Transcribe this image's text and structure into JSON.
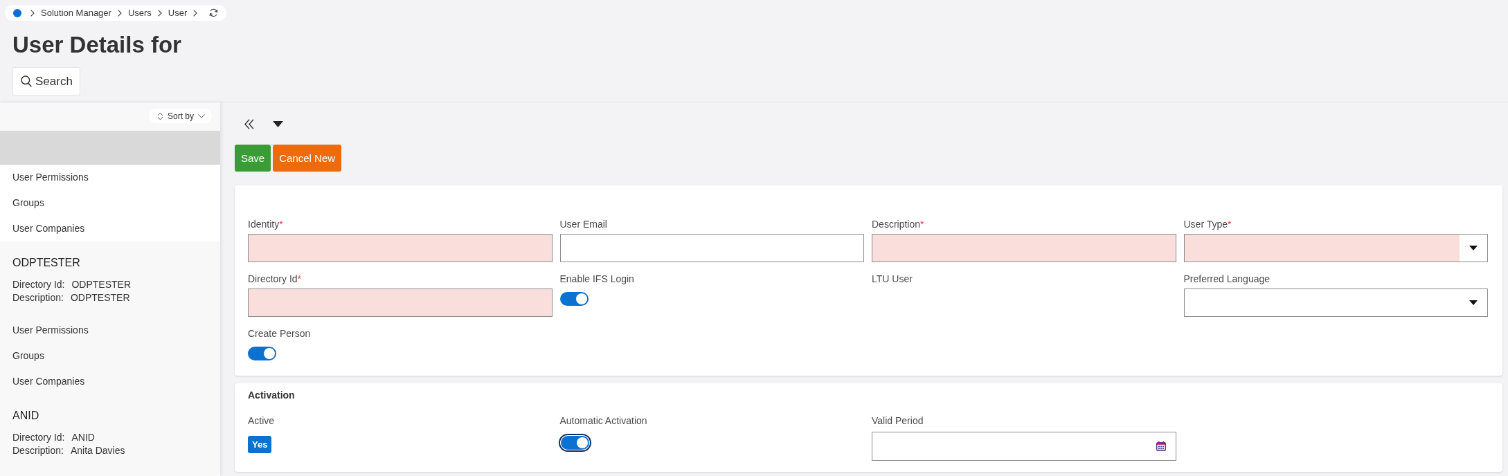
{
  "breadcrumb": {
    "items": [
      "Solution Manager",
      "Users",
      "User"
    ]
  },
  "page_title": "User Details for",
  "search_button": "Search",
  "sidebar": {
    "sort_label": "Sort by",
    "records": [
      {
        "selected": true,
        "links": [
          "User Permissions",
          "Groups",
          "User Companies"
        ]
      },
      {
        "selected": false,
        "title": "ODPTESTER",
        "details": [
          {
            "label": "Directory Id:",
            "value": "ODPTESTER"
          },
          {
            "label": "Description:",
            "value": "ODPTESTER"
          }
        ],
        "links": [
          "User Permissions",
          "Groups",
          "User Companies"
        ]
      },
      {
        "selected": false,
        "title": "ANID",
        "details": [
          {
            "label": "Directory Id:",
            "value": "ANID"
          },
          {
            "label": "Description:",
            "value": "Anita Davies"
          }
        ]
      }
    ]
  },
  "toolbar": {
    "buttons": [
      {
        "kind": "save",
        "label": "Save"
      },
      {
        "kind": "cancel",
        "label": "Cancel New"
      }
    ]
  },
  "details_form": {
    "fields": [
      {
        "kind": "text",
        "label": "Identity",
        "asterisk": "*",
        "required": true
      },
      {
        "kind": "text",
        "label": "User Email",
        "required": false
      },
      {
        "kind": "text",
        "label": "Description",
        "asterisk": "*",
        "required": true
      },
      {
        "kind": "select",
        "label": "User Type",
        "asterisk": "*",
        "required": true
      },
      {
        "kind": "text",
        "label": "Directory Id",
        "asterisk": "*",
        "required": true
      },
      {
        "kind": "toggle",
        "label": "Enable IFS Login",
        "on": true
      },
      {
        "kind": "label",
        "label": "LTU User"
      },
      {
        "kind": "select",
        "label": "Preferred Language",
        "required": false
      },
      {
        "kind": "toggle",
        "label": "Create Person",
        "on": true
      }
    ]
  },
  "activation": {
    "title": "Activation",
    "fields": [
      {
        "kind": "badge",
        "label": "Active",
        "value": "Yes"
      },
      {
        "kind": "toggle",
        "label": "Automatic Activation",
        "on": true,
        "focused": true
      },
      {
        "kind": "date",
        "label": "Valid Period"
      }
    ]
  }
}
